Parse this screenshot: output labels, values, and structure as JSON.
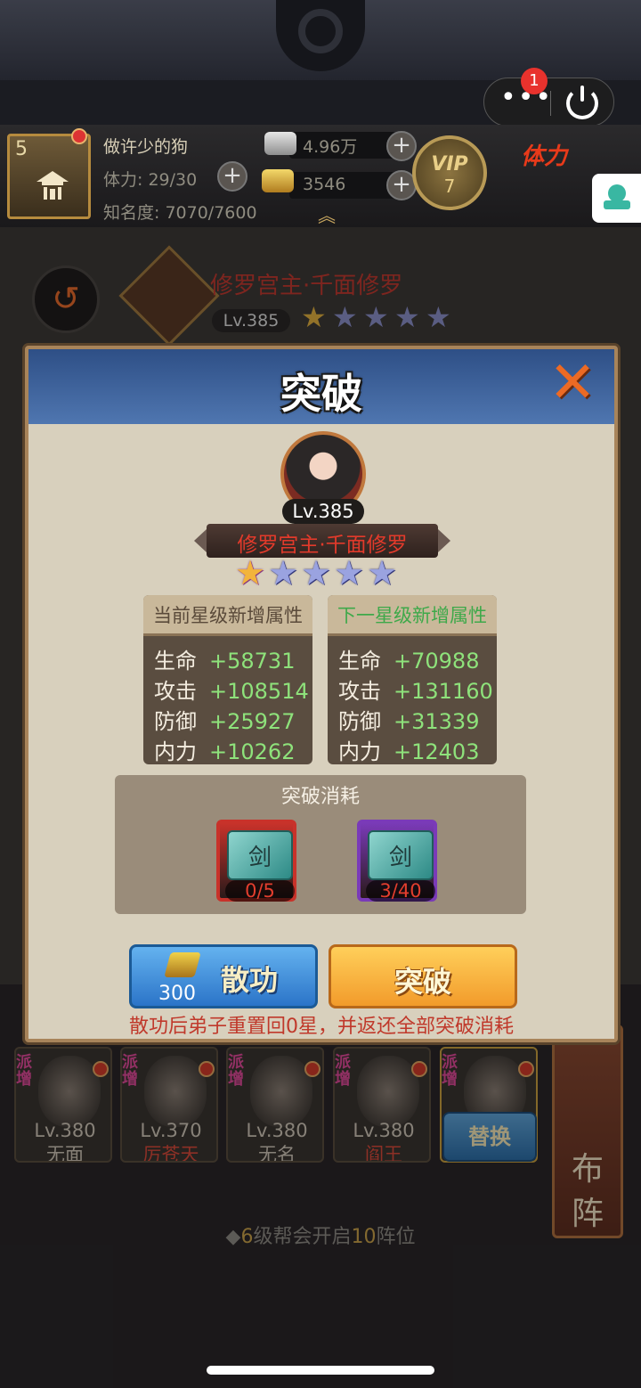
{
  "top_capsule": {
    "more_icon": "ellipsis-icon",
    "close_icon": "power-icon",
    "notification_count": "1"
  },
  "player": {
    "level": "5",
    "name": "做许少的狗",
    "stamina": "体力: 29/30",
    "fame": "知名度: 7070/7600",
    "silver": "4.96万",
    "gold": "3546",
    "vip_label": "VIP",
    "vip_level": "7",
    "stamina_banner": "体力"
  },
  "background_hero": {
    "name": "修罗宫主·千面修罗",
    "level": "Lv.385"
  },
  "dialog": {
    "title": "突破",
    "hero": {
      "level": "Lv.385",
      "name": "修罗宫主·千面修罗",
      "stars_lit": 1,
      "stars_total": 5
    },
    "current_panel": {
      "header": "当前星级新增属性",
      "header_color": "#5a4a3a",
      "rows": [
        {
          "key": "生命",
          "value": "+58731"
        },
        {
          "key": "攻击",
          "value": "+108514"
        },
        {
          "key": "防御",
          "value": "+25927"
        },
        {
          "key": "内力",
          "value": "+10262"
        }
      ]
    },
    "next_panel": {
      "header": "下一星级新增属性",
      "header_color": "#3ea94a",
      "rows": [
        {
          "key": "生命",
          "value": "+70988"
        },
        {
          "key": "攻击",
          "value": "+131160"
        },
        {
          "key": "防御",
          "value": "+31339"
        },
        {
          "key": "内力",
          "value": "+12403"
        }
      ]
    },
    "cost": {
      "title": "突破消耗",
      "items": [
        {
          "glyph": "剑",
          "count": "0/5",
          "frame_color": "#c8322a"
        },
        {
          "glyph": "剑",
          "count": "3/40",
          "frame_color": "#7a3ab8"
        }
      ]
    },
    "sangong_button": {
      "label": "散功",
      "cost": "300"
    },
    "break_button": {
      "label": "突破"
    },
    "warning": "散功后弟子重置回0星，并返还全部突破消耗"
  },
  "team": [
    {
      "tag": "派增",
      "level": "Lv.380",
      "name": "无面",
      "red": false
    },
    {
      "tag": "派增",
      "level": "Lv.370",
      "name": "厉苍天",
      "red": true
    },
    {
      "tag": "派增",
      "level": "Lv.380",
      "name": "无名",
      "red": false
    },
    {
      "tag": "派增",
      "level": "Lv.380",
      "name": "阎王",
      "red": true
    },
    {
      "tag": "派增",
      "level": "",
      "name": "",
      "red": false
    }
  ],
  "replace_button": "替换",
  "lineup_button": [
    "布",
    "阵"
  ],
  "unlock_tip": {
    "prefix": "◆",
    "n1": "6",
    "mid": "级帮会开启",
    "n2": "10",
    "suffix": "阵位"
  }
}
